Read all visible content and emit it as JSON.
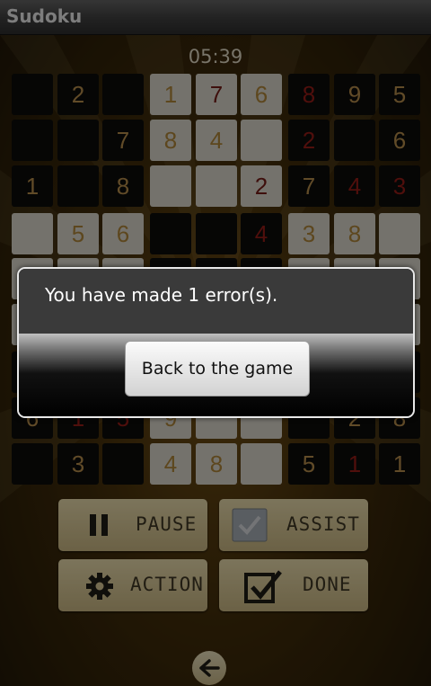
{
  "app": {
    "title": "Sudoku"
  },
  "timer": "05:39",
  "board": [
    [
      {
        "v": "",
        "s": "dark"
      },
      {
        "v": "2",
        "s": "dark",
        "c": "given"
      },
      {
        "v": "",
        "s": "dark"
      },
      {
        "v": "1",
        "s": "light",
        "c": "given"
      },
      {
        "v": "7",
        "s": "light",
        "c": "redlight"
      },
      {
        "v": "6",
        "s": "light",
        "c": "given"
      },
      {
        "v": "8",
        "s": "dark",
        "c": "red"
      },
      {
        "v": "9",
        "s": "dark",
        "c": "given"
      },
      {
        "v": "5",
        "s": "dark",
        "c": "given"
      }
    ],
    [
      {
        "v": "",
        "s": "dark"
      },
      {
        "v": "",
        "s": "dark"
      },
      {
        "v": "7",
        "s": "dark",
        "c": "given"
      },
      {
        "v": "8",
        "s": "light",
        "c": "given"
      },
      {
        "v": "4",
        "s": "light",
        "c": "given"
      },
      {
        "v": "",
        "s": "light"
      },
      {
        "v": "2",
        "s": "dark",
        "c": "red"
      },
      {
        "v": "",
        "s": "dark"
      },
      {
        "v": "6",
        "s": "dark",
        "c": "given"
      }
    ],
    [
      {
        "v": "1",
        "s": "dark",
        "c": "given"
      },
      {
        "v": "",
        "s": "dark"
      },
      {
        "v": "8",
        "s": "dark",
        "c": "given"
      },
      {
        "v": "",
        "s": "light"
      },
      {
        "v": "",
        "s": "light"
      },
      {
        "v": "2",
        "s": "light",
        "c": "redlight"
      },
      {
        "v": "7",
        "s": "dark",
        "c": "given"
      },
      {
        "v": "4",
        "s": "dark",
        "c": "red"
      },
      {
        "v": "3",
        "s": "dark",
        "c": "red"
      }
    ],
    [
      {
        "v": "",
        "s": "light"
      },
      {
        "v": "5",
        "s": "light",
        "c": "given"
      },
      {
        "v": "6",
        "s": "light",
        "c": "given"
      },
      {
        "v": "",
        "s": "dark"
      },
      {
        "v": "",
        "s": "dark"
      },
      {
        "v": "4",
        "s": "dark",
        "c": "red"
      },
      {
        "v": "3",
        "s": "light",
        "c": "given"
      },
      {
        "v": "8",
        "s": "light",
        "c": "given"
      },
      {
        "v": "",
        "s": "light"
      }
    ],
    [
      {
        "v": "",
        "s": "light"
      },
      {
        "v": "",
        "s": "light"
      },
      {
        "v": "",
        "s": "light"
      },
      {
        "v": "",
        "s": "dark"
      },
      {
        "v": "",
        "s": "dark"
      },
      {
        "v": "",
        "s": "dark"
      },
      {
        "v": "",
        "s": "light"
      },
      {
        "v": "",
        "s": "light"
      },
      {
        "v": "",
        "s": "light"
      }
    ],
    [
      {
        "v": "",
        "s": "light"
      },
      {
        "v": "",
        "s": "light"
      },
      {
        "v": "",
        "s": "light"
      },
      {
        "v": "",
        "s": "dark"
      },
      {
        "v": "",
        "s": "dark"
      },
      {
        "v": "",
        "s": "dark"
      },
      {
        "v": "",
        "s": "light"
      },
      {
        "v": "",
        "s": "light"
      },
      {
        "v": "",
        "s": "light"
      }
    ],
    [
      {
        "v": "",
        "s": "dark"
      },
      {
        "v": "",
        "s": "dark"
      },
      {
        "v": "",
        "s": "dark"
      },
      {
        "v": "",
        "s": "light"
      },
      {
        "v": "",
        "s": "light"
      },
      {
        "v": "",
        "s": "light"
      },
      {
        "v": "",
        "s": "dark"
      },
      {
        "v": "",
        "s": "dark"
      },
      {
        "v": "",
        "s": "dark"
      }
    ],
    [
      {
        "v": "6",
        "s": "dark",
        "c": "given"
      },
      {
        "v": "1",
        "s": "dark",
        "c": "red"
      },
      {
        "v": "5",
        "s": "dark",
        "c": "red"
      },
      {
        "v": "9",
        "s": "light",
        "c": "given"
      },
      {
        "v": "",
        "s": "light"
      },
      {
        "v": "",
        "s": "light"
      },
      {
        "v": "",
        "s": "dark"
      },
      {
        "v": "2",
        "s": "dark",
        "c": "given"
      },
      {
        "v": "8",
        "s": "dark",
        "c": "given"
      }
    ],
    [
      {
        "v": "",
        "s": "dark"
      },
      {
        "v": "3",
        "s": "dark",
        "c": "given"
      },
      {
        "v": "",
        "s": "dark"
      },
      {
        "v": "4",
        "s": "light",
        "c": "given"
      },
      {
        "v": "8",
        "s": "light",
        "c": "given"
      },
      {
        "v": "",
        "s": "light"
      },
      {
        "v": "5",
        "s": "dark",
        "c": "given"
      },
      {
        "v": "1",
        "s": "dark",
        "c": "red"
      },
      {
        "v": "1",
        "s": "dark",
        "c": "given"
      }
    ]
  ],
  "controls": {
    "pause_label": "PAUSE",
    "assist_label": "ASSIST",
    "action_label": "ACTION",
    "done_label": "DONE"
  },
  "icons": {
    "pause": "pause-icon",
    "assist": "checkbox-icon",
    "action": "gear-icon",
    "done": "checkmark-box-icon",
    "back": "back-arrow-icon"
  },
  "dialog": {
    "message": "You have made 1 error(s).",
    "button_label": "Back to the game"
  },
  "colors": {
    "dialog_bg": "#3a3a3a",
    "board_light": "#c9c5ba",
    "board_dark": "#0b0b0a",
    "button_bg": "#c9b98a",
    "error_red": "#8a1a16"
  }
}
